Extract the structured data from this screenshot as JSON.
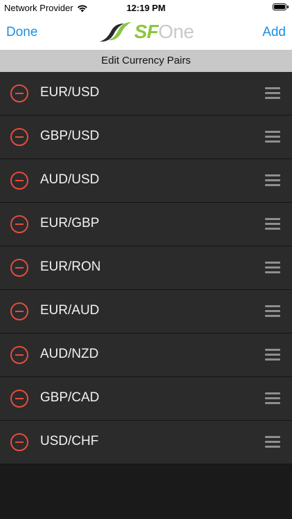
{
  "status_bar": {
    "carrier": "Network Provider",
    "time": "12:19 PM"
  },
  "nav": {
    "done_label": "Done",
    "add_label": "Add",
    "logo_sf": "SF",
    "logo_one": "One"
  },
  "section": {
    "title": "Edit Currency Pairs"
  },
  "pairs": [
    "EUR/USD",
    "GBP/USD",
    "AUD/USD",
    "EUR/GBP",
    "EUR/RON",
    "EUR/AUD",
    "AUD/NZD",
    "GBP/CAD",
    "USD/CHF"
  ],
  "colors": {
    "accent": "#1a8fe3",
    "delete": "#e74c3c",
    "logo_green": "#8cc63f",
    "row_bg": "#2b2b2b",
    "page_bg": "#1a1a1a"
  }
}
